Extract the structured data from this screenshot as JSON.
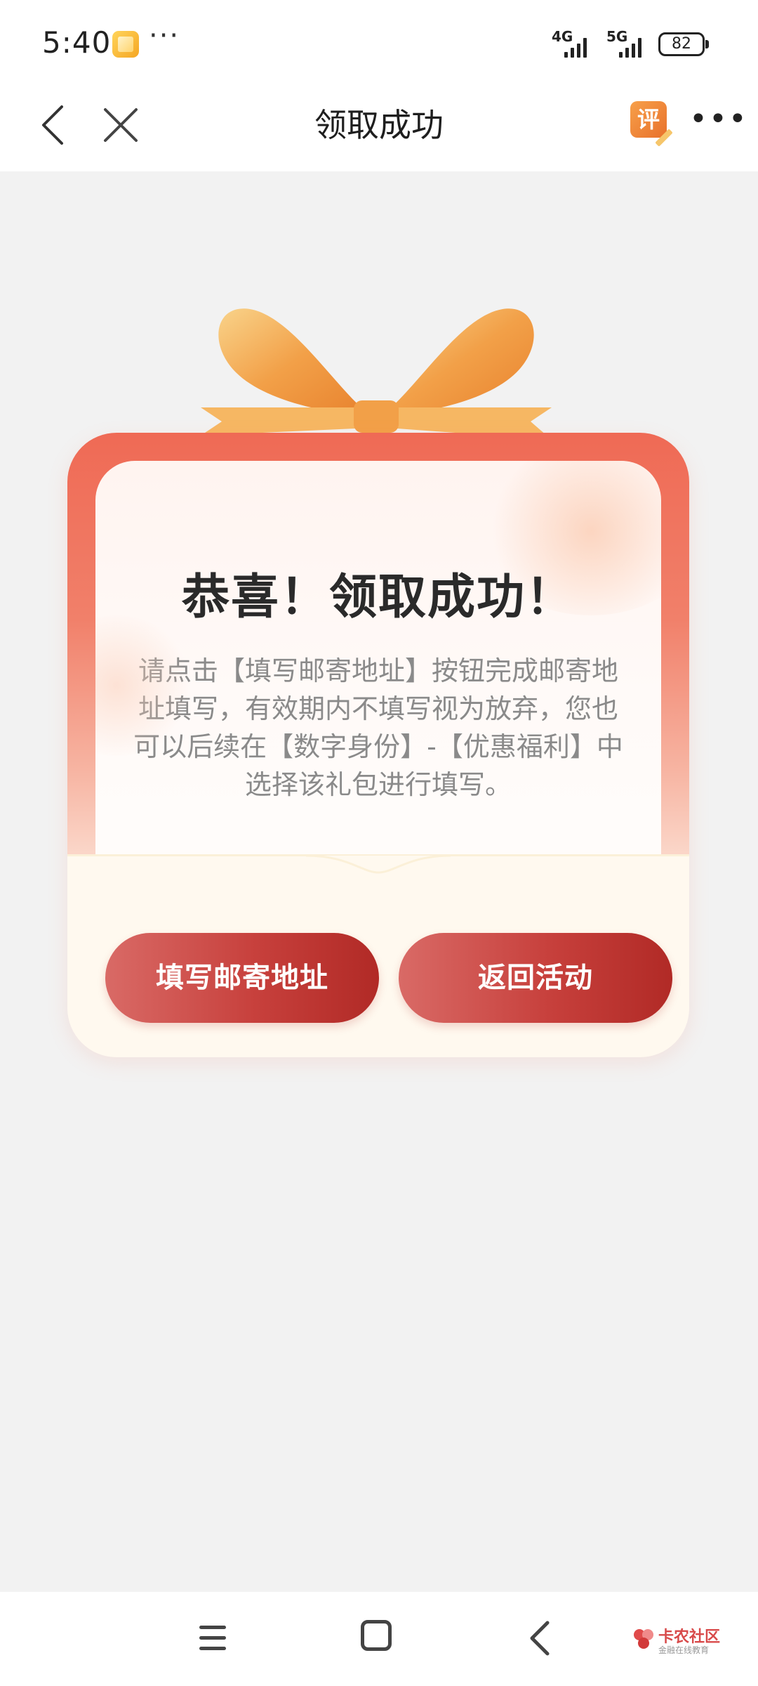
{
  "status_bar": {
    "time": "5:40",
    "more": "···",
    "signal_1": "4G",
    "signal_2": "5G",
    "battery": "82"
  },
  "nav": {
    "title": "领取成功",
    "review_icon_text": "评",
    "more": "•••"
  },
  "card": {
    "heading": "恭喜！领取成功！",
    "description": "请点击【填写邮寄地址】按钮完成邮寄地址填写，有效期内不填写视为放弃，您也可以后续在【数字身份】-【优惠福利】中选择该礼包进行填写。",
    "fill_button": "填写邮寄地址",
    "back_button": "返回活动"
  },
  "watermark": {
    "main": "卡农社区",
    "sub": "金融在线教育"
  },
  "colors": {
    "accent_red": "#c7403c",
    "frame_red": "#ef6a55",
    "ribbon_orange": "#f2a048"
  },
  "icons": {
    "back": "chevron-left-icon",
    "close": "close-icon",
    "review": "review-icon",
    "more": "more-dots-icon",
    "menu": "menu-icon",
    "home": "home-icon",
    "nav_back": "back-icon"
  }
}
